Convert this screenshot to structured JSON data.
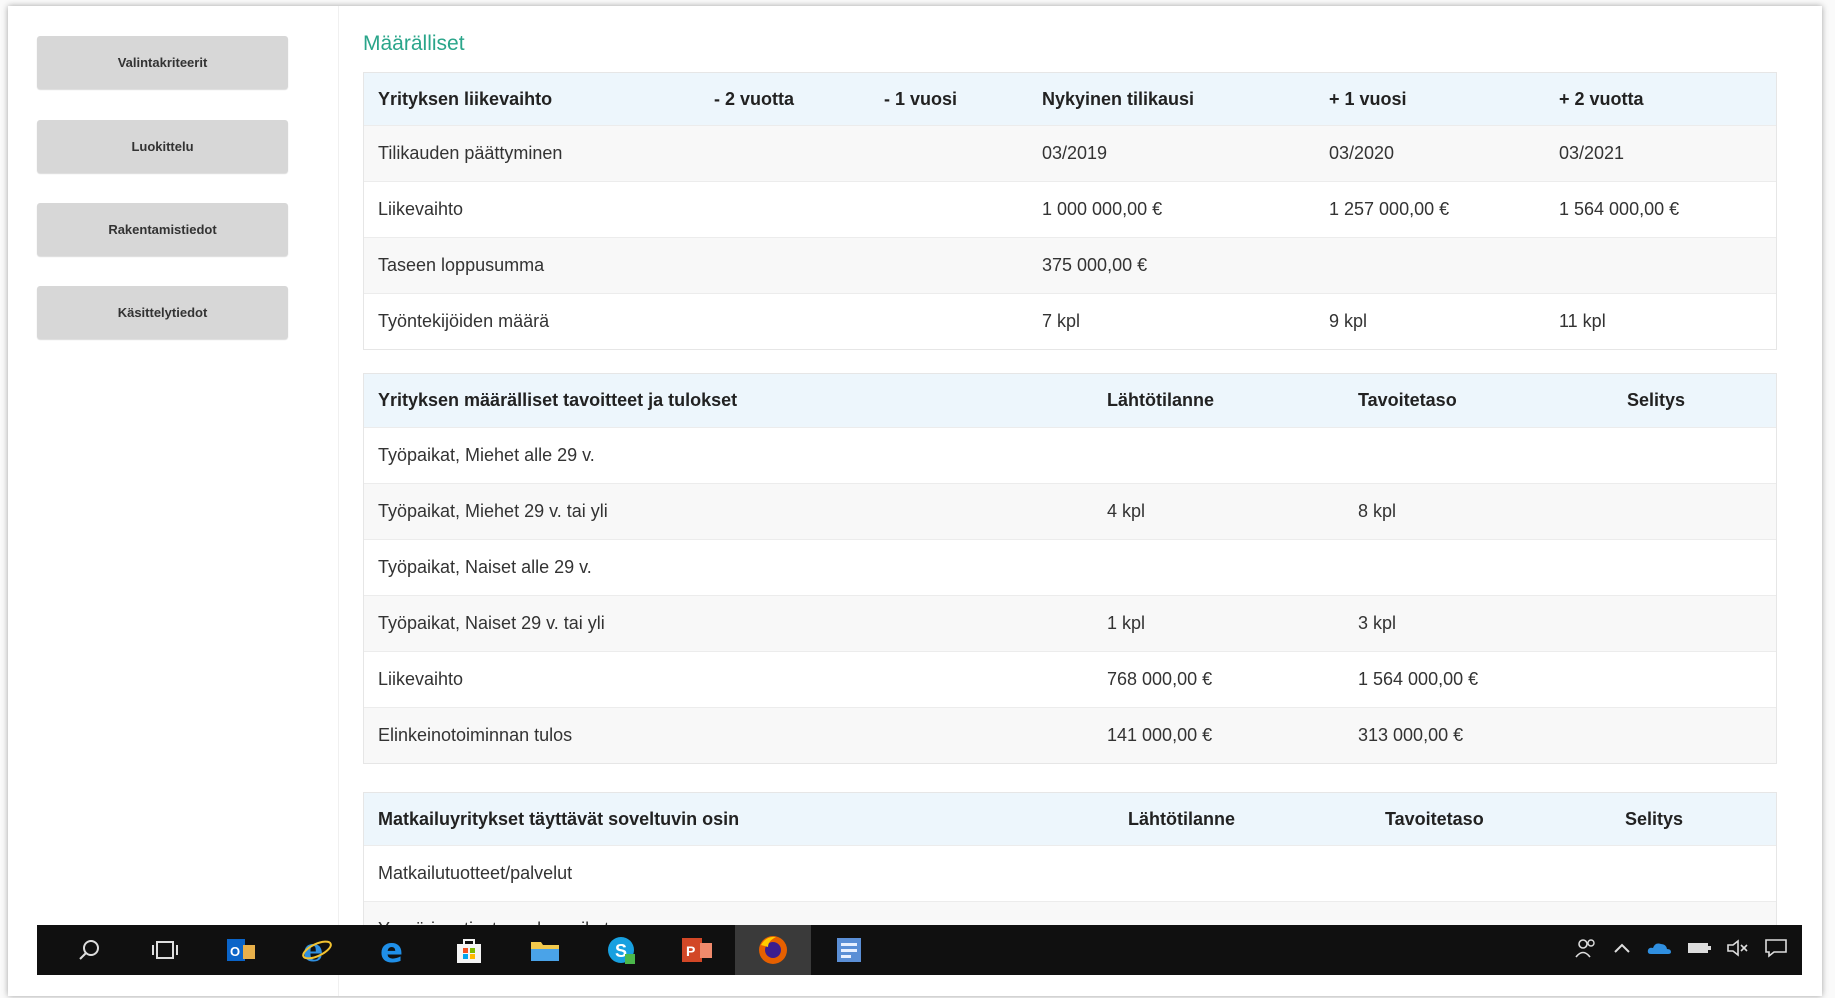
{
  "sidebar": {
    "buttons": [
      "Valintakriteerit",
      "Luokittelu",
      "Rakentamistiedot",
      "Käsittelytiedot"
    ]
  },
  "section_title": "Määrälliset",
  "table1": {
    "headers": [
      "Yrityksen liikevaihto",
      "- 2 vuotta",
      "- 1 vuosi",
      "Nykyinen tilikausi",
      "+ 1 vuosi",
      "+ 2 vuotta"
    ],
    "rows": [
      [
        "Tilikauden päättyminen",
        "",
        "",
        "03/2019",
        "03/2020",
        "03/2021"
      ],
      [
        "Liikevaihto",
        "",
        "",
        "1 000 000,00 €",
        "1 257 000,00 €",
        "1 564 000,00 €"
      ],
      [
        "Taseen loppusumma",
        "",
        "",
        "375 000,00 €",
        "",
        ""
      ],
      [
        "Työntekijöiden määrä",
        "",
        "",
        "7 kpl",
        "9 kpl",
        "11 kpl"
      ]
    ]
  },
  "table2": {
    "headers": [
      "Yrityksen määrälliset tavoitteet ja tulokset",
      "Lähtötilanne",
      "Tavoitetaso",
      "Selitys"
    ],
    "rows": [
      [
        "Työpaikat, Miehet alle 29 v.",
        "",
        "",
        ""
      ],
      [
        "Työpaikat, Miehet 29 v. tai yli",
        "4 kpl",
        "8 kpl",
        ""
      ],
      [
        "Työpaikat, Naiset alle 29 v.",
        "",
        "",
        ""
      ],
      [
        "Työpaikat, Naiset 29 v. tai yli",
        "1 kpl",
        "3 kpl",
        ""
      ],
      [
        "Liikevaihto",
        "768 000,00 €",
        "1 564 000,00 €",
        ""
      ],
      [
        "Elinkeinotoiminnan tulos",
        "141 000,00 €",
        "313 000,00 €",
        ""
      ]
    ]
  },
  "table3": {
    "headers": [
      "Matkailuyritykset täyttävät soveltuvin osin",
      "Lähtötilanne",
      "Tavoitetaso",
      "Selitys"
    ],
    "rows": [
      [
        "Matkailutuotteet/palvelut",
        "",
        "",
        ""
      ],
      [
        "Ympärivuotiset vuodenpaikat",
        "",
        "",
        ""
      ]
    ]
  },
  "taskbar": {
    "icons": [
      "search-icon",
      "task-view-icon",
      "outlook-icon",
      "internet-explorer-icon",
      "edge-icon",
      "store-icon",
      "file-explorer-icon",
      "skype-icon",
      "powerpoint-icon",
      "firefox-icon",
      "app-icon"
    ],
    "tray_icons": [
      "people-icon",
      "chevron-up-icon",
      "onedrive-icon",
      "battery-icon",
      "volume-icon",
      "notification-icon"
    ]
  }
}
